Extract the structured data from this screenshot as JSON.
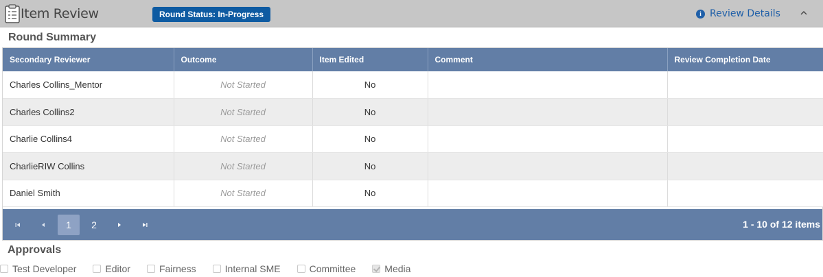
{
  "header": {
    "title": "Item Review",
    "status_badge": "Round Status: In-Progress",
    "review_details_label": "Review Details",
    "clipboard_icon": "clipboard-icon",
    "info_icon": "info-circle-icon",
    "collapse_icon": "chevron-up-icon"
  },
  "round_summary": {
    "title": "Round Summary",
    "columns": [
      "Secondary Reviewer",
      "Outcome",
      "Item Edited",
      "Comment",
      "Review Completion Date"
    ],
    "rows": [
      {
        "reviewer": "Charles Collins_Mentor",
        "outcome": "Not Started",
        "edited": "No",
        "comment": "",
        "date": ""
      },
      {
        "reviewer": "Charles Collins2",
        "outcome": "Not Started",
        "edited": "No",
        "comment": "",
        "date": ""
      },
      {
        "reviewer": "Charlie Collins4",
        "outcome": "Not Started",
        "edited": "No",
        "comment": "",
        "date": ""
      },
      {
        "reviewer": "CharlieRIW Collins",
        "outcome": "Not Started",
        "edited": "No",
        "comment": "",
        "date": ""
      },
      {
        "reviewer": "Daniel Smith",
        "outcome": "Not Started",
        "edited": "No",
        "comment": "",
        "date": ""
      }
    ]
  },
  "pager": {
    "pages": [
      "1",
      "2"
    ],
    "active_page": "1",
    "info": "1 - 10 of 12 items"
  },
  "approvals": {
    "title": "Approvals",
    "items": [
      {
        "label": "Test Developer",
        "checked": false
      },
      {
        "label": "Editor",
        "checked": false
      },
      {
        "label": "Fairness",
        "checked": false
      },
      {
        "label": "Internal SME",
        "checked": false
      },
      {
        "label": "Committee",
        "checked": false
      },
      {
        "label": "Media",
        "checked": true
      }
    ]
  },
  "colors": {
    "header_bg": "#c6c6c6",
    "badge_bg": "#0e5ba2",
    "grid_header_bg": "#627ea6",
    "link": "#1f5fa8"
  }
}
